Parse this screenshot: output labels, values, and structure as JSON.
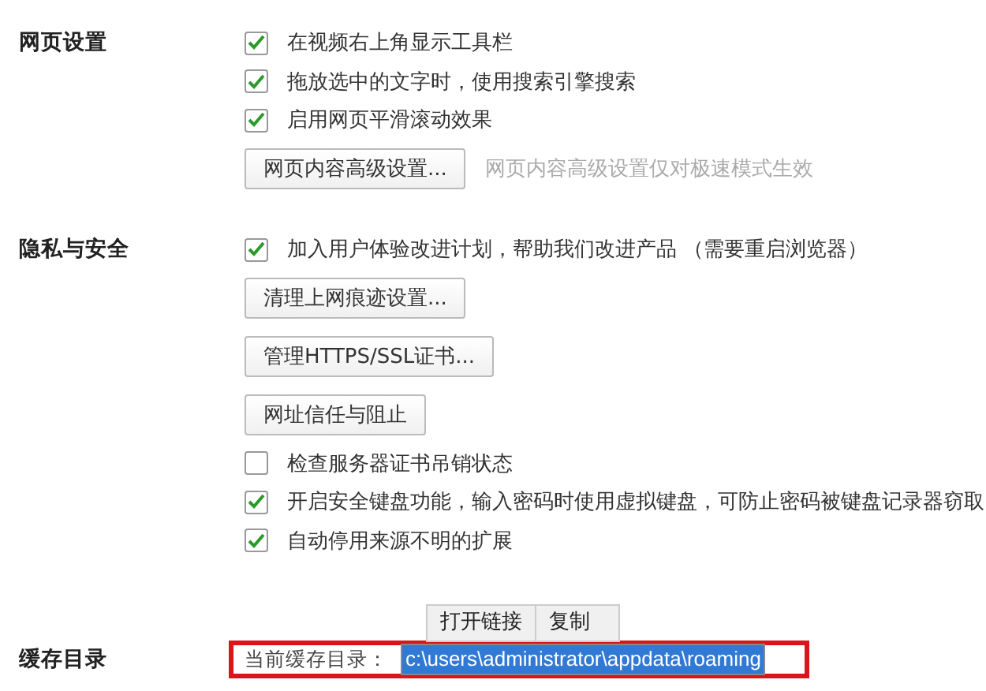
{
  "sections": [
    {
      "title": "网页设置",
      "items": [
        {
          "kind": "checkbox",
          "label": "在视频右上角显示工具栏",
          "checked": true
        },
        {
          "kind": "checkbox",
          "label": "拖放选中的文字时，使用搜索引擎搜索",
          "checked": true
        },
        {
          "kind": "checkbox",
          "label": "启用网页平滑滚动效果",
          "checked": true
        },
        {
          "kind": "button",
          "label": "网页内容高级设置...",
          "hint": "网页内容高级设置仅对极速模式生效"
        }
      ]
    },
    {
      "title": "隐私与安全",
      "items": [
        {
          "kind": "checkbox",
          "label": "加入用户体验改进计划，帮助我们改进产品 （需要重启浏览器）",
          "checked": true
        },
        {
          "kind": "button",
          "label": "清理上网痕迹设置..."
        },
        {
          "kind": "button",
          "label": "管理HTTPS/SSL证书..."
        },
        {
          "kind": "button",
          "label": "网址信任与阻止"
        },
        {
          "kind": "checkbox",
          "label": "检查服务器证书吊销状态",
          "checked": false
        },
        {
          "kind": "checkbox",
          "label": "开启安全键盘功能，输入密码时使用虚拟键盘，可防止密码被键盘记录器窃取",
          "checked": true
        },
        {
          "kind": "checkbox",
          "label": "自动停用来源不明的扩展",
          "checked": true
        }
      ]
    },
    {
      "title": "缓存目录",
      "items": [
        {
          "kind": "path",
          "label": "当前缓存目录：",
          "value": "c:\\users\\administrator\\appdata\\roaming"
        }
      ]
    }
  ],
  "context_menu": {
    "items": [
      "打开链接",
      "复制"
    ]
  }
}
